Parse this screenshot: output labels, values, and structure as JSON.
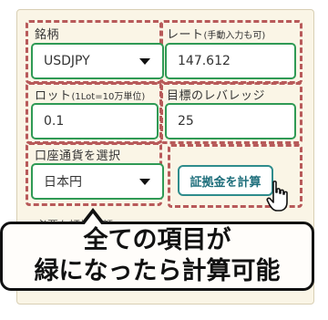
{
  "form": {
    "symbol": {
      "label": "銘柄",
      "value": "USDJPY"
    },
    "rate": {
      "label": "レート",
      "note": "(手動入力も可)",
      "value": "147.612"
    },
    "lot": {
      "label": "ロット",
      "note": "(1Lot=10万単位)",
      "value": "0.1"
    },
    "leverage": {
      "label": "目標のレバレッジ",
      "value": "25"
    },
    "currency": {
      "label": "口座通貨を選択",
      "value": "日本円"
    },
    "calculate_button": "証拠金を計算",
    "result_label": "必要な証拠金額"
  },
  "callout": {
    "line1": "全ての項目が",
    "line2": "緑になったら計算可能"
  },
  "colors": {
    "field_border": "#2f9a55",
    "dashed_highlight": "#b85a5a",
    "button_text": "#1f6f7c",
    "panel_background": "#faf5e6"
  },
  "icons": [
    "chevron-down-icon",
    "pointer-hand-icon"
  ]
}
